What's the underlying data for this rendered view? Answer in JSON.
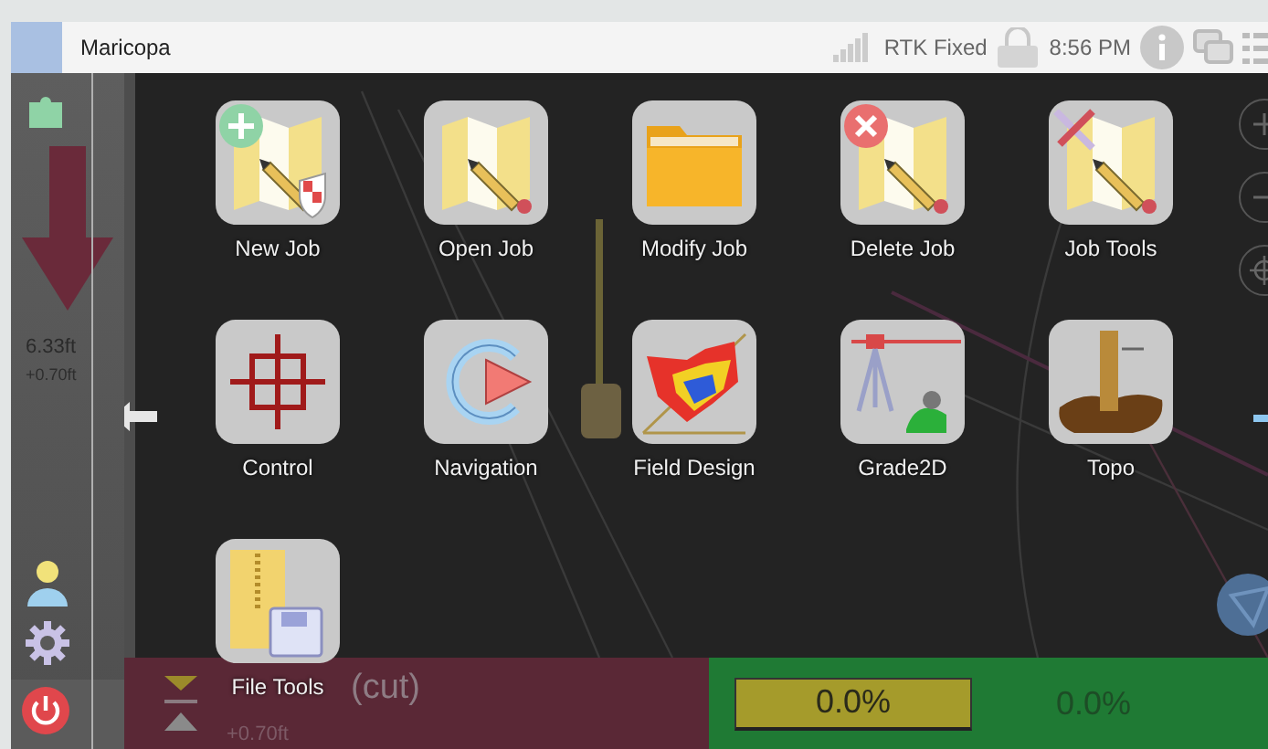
{
  "title_bar": {
    "title": "Maricopa",
    "gps_status": "RTK Fixed",
    "time": "8:56 PM"
  },
  "guidance": {
    "depth": "6.33ft",
    "offset": "+0.70ft"
  },
  "apps": [
    {
      "label": "New Job",
      "kind": "new-job"
    },
    {
      "label": "Open Job",
      "kind": "open-job"
    },
    {
      "label": "Modify Job",
      "kind": "modify-job"
    },
    {
      "label": "Delete Job",
      "kind": "delete-job"
    },
    {
      "label": "Job Tools",
      "kind": "job-tools"
    },
    {
      "label": "Control",
      "kind": "control"
    },
    {
      "label": "Navigation",
      "kind": "navigation"
    },
    {
      "label": "Field Design",
      "kind": "field-design"
    },
    {
      "label": "Grade2D",
      "kind": "grade2d"
    },
    {
      "label": "Topo",
      "kind": "topo"
    },
    {
      "label": "File Tools",
      "kind": "file-tools"
    }
  ],
  "bottom_bar": {
    "cut_label": "(cut)",
    "offset": "+0.70ft",
    "reading_1": "0.0%",
    "reading_2": "0.0%"
  }
}
